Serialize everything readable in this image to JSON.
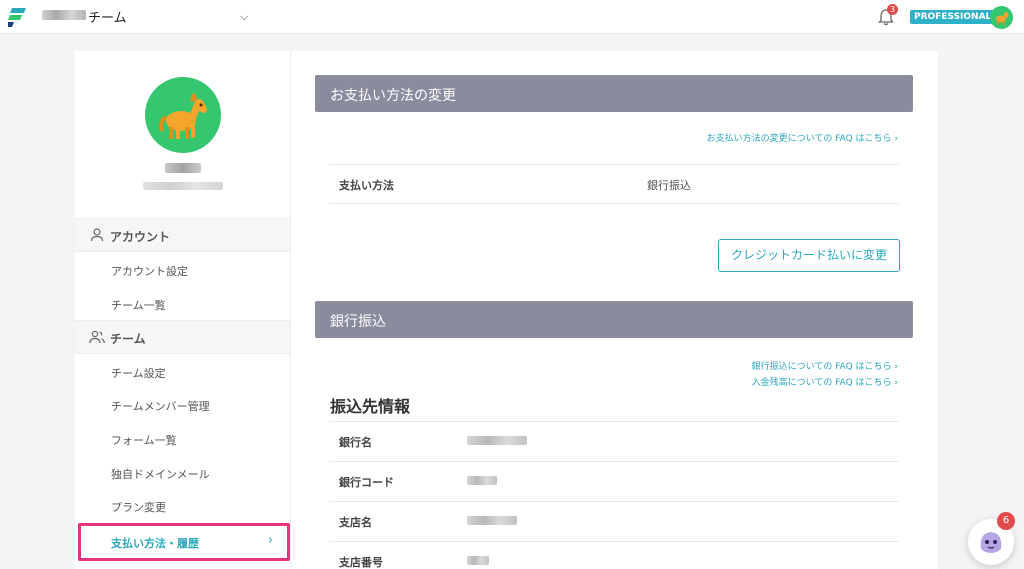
{
  "header": {
    "team_suffix": "チーム",
    "plan_badge": "PROFESSIONAL",
    "notification_count": "3"
  },
  "sidebar": {
    "sections": [
      {
        "label": "アカウント",
        "items": [
          "アカウント設定",
          "チーム一覧"
        ]
      },
      {
        "label": "チーム",
        "items": [
          "チーム設定",
          "チームメンバー管理",
          "フォーム一覧",
          "独自ドメインメール",
          "プラン変更"
        ]
      }
    ],
    "active_item": "支払い方法・履歴"
  },
  "main": {
    "payment_change": {
      "title": "お支払い方法の変更",
      "faq_link": "お支払い方法の変更についての FAQ はこちら",
      "method_label": "支払い方法",
      "method_value": "銀行振込",
      "change_button": "クレジットカード払いに変更"
    },
    "bank_transfer": {
      "title": "銀行振込",
      "faq_link_1": "銀行振込についての FAQ はこちら",
      "faq_link_2": "入金残高についての FAQ はこちら",
      "info_title": "振込先情報",
      "rows": [
        {
          "label": "銀行名"
        },
        {
          "label": "銀行コード"
        },
        {
          "label": "支店名"
        },
        {
          "label": "支店番号"
        }
      ]
    }
  },
  "chat": {
    "badge_count": "6"
  },
  "colors": {
    "accent": "#2aa8bd",
    "header_bar": "#8a8b9d",
    "highlight": "#e7327c",
    "avatar_bg": "#35c770"
  }
}
